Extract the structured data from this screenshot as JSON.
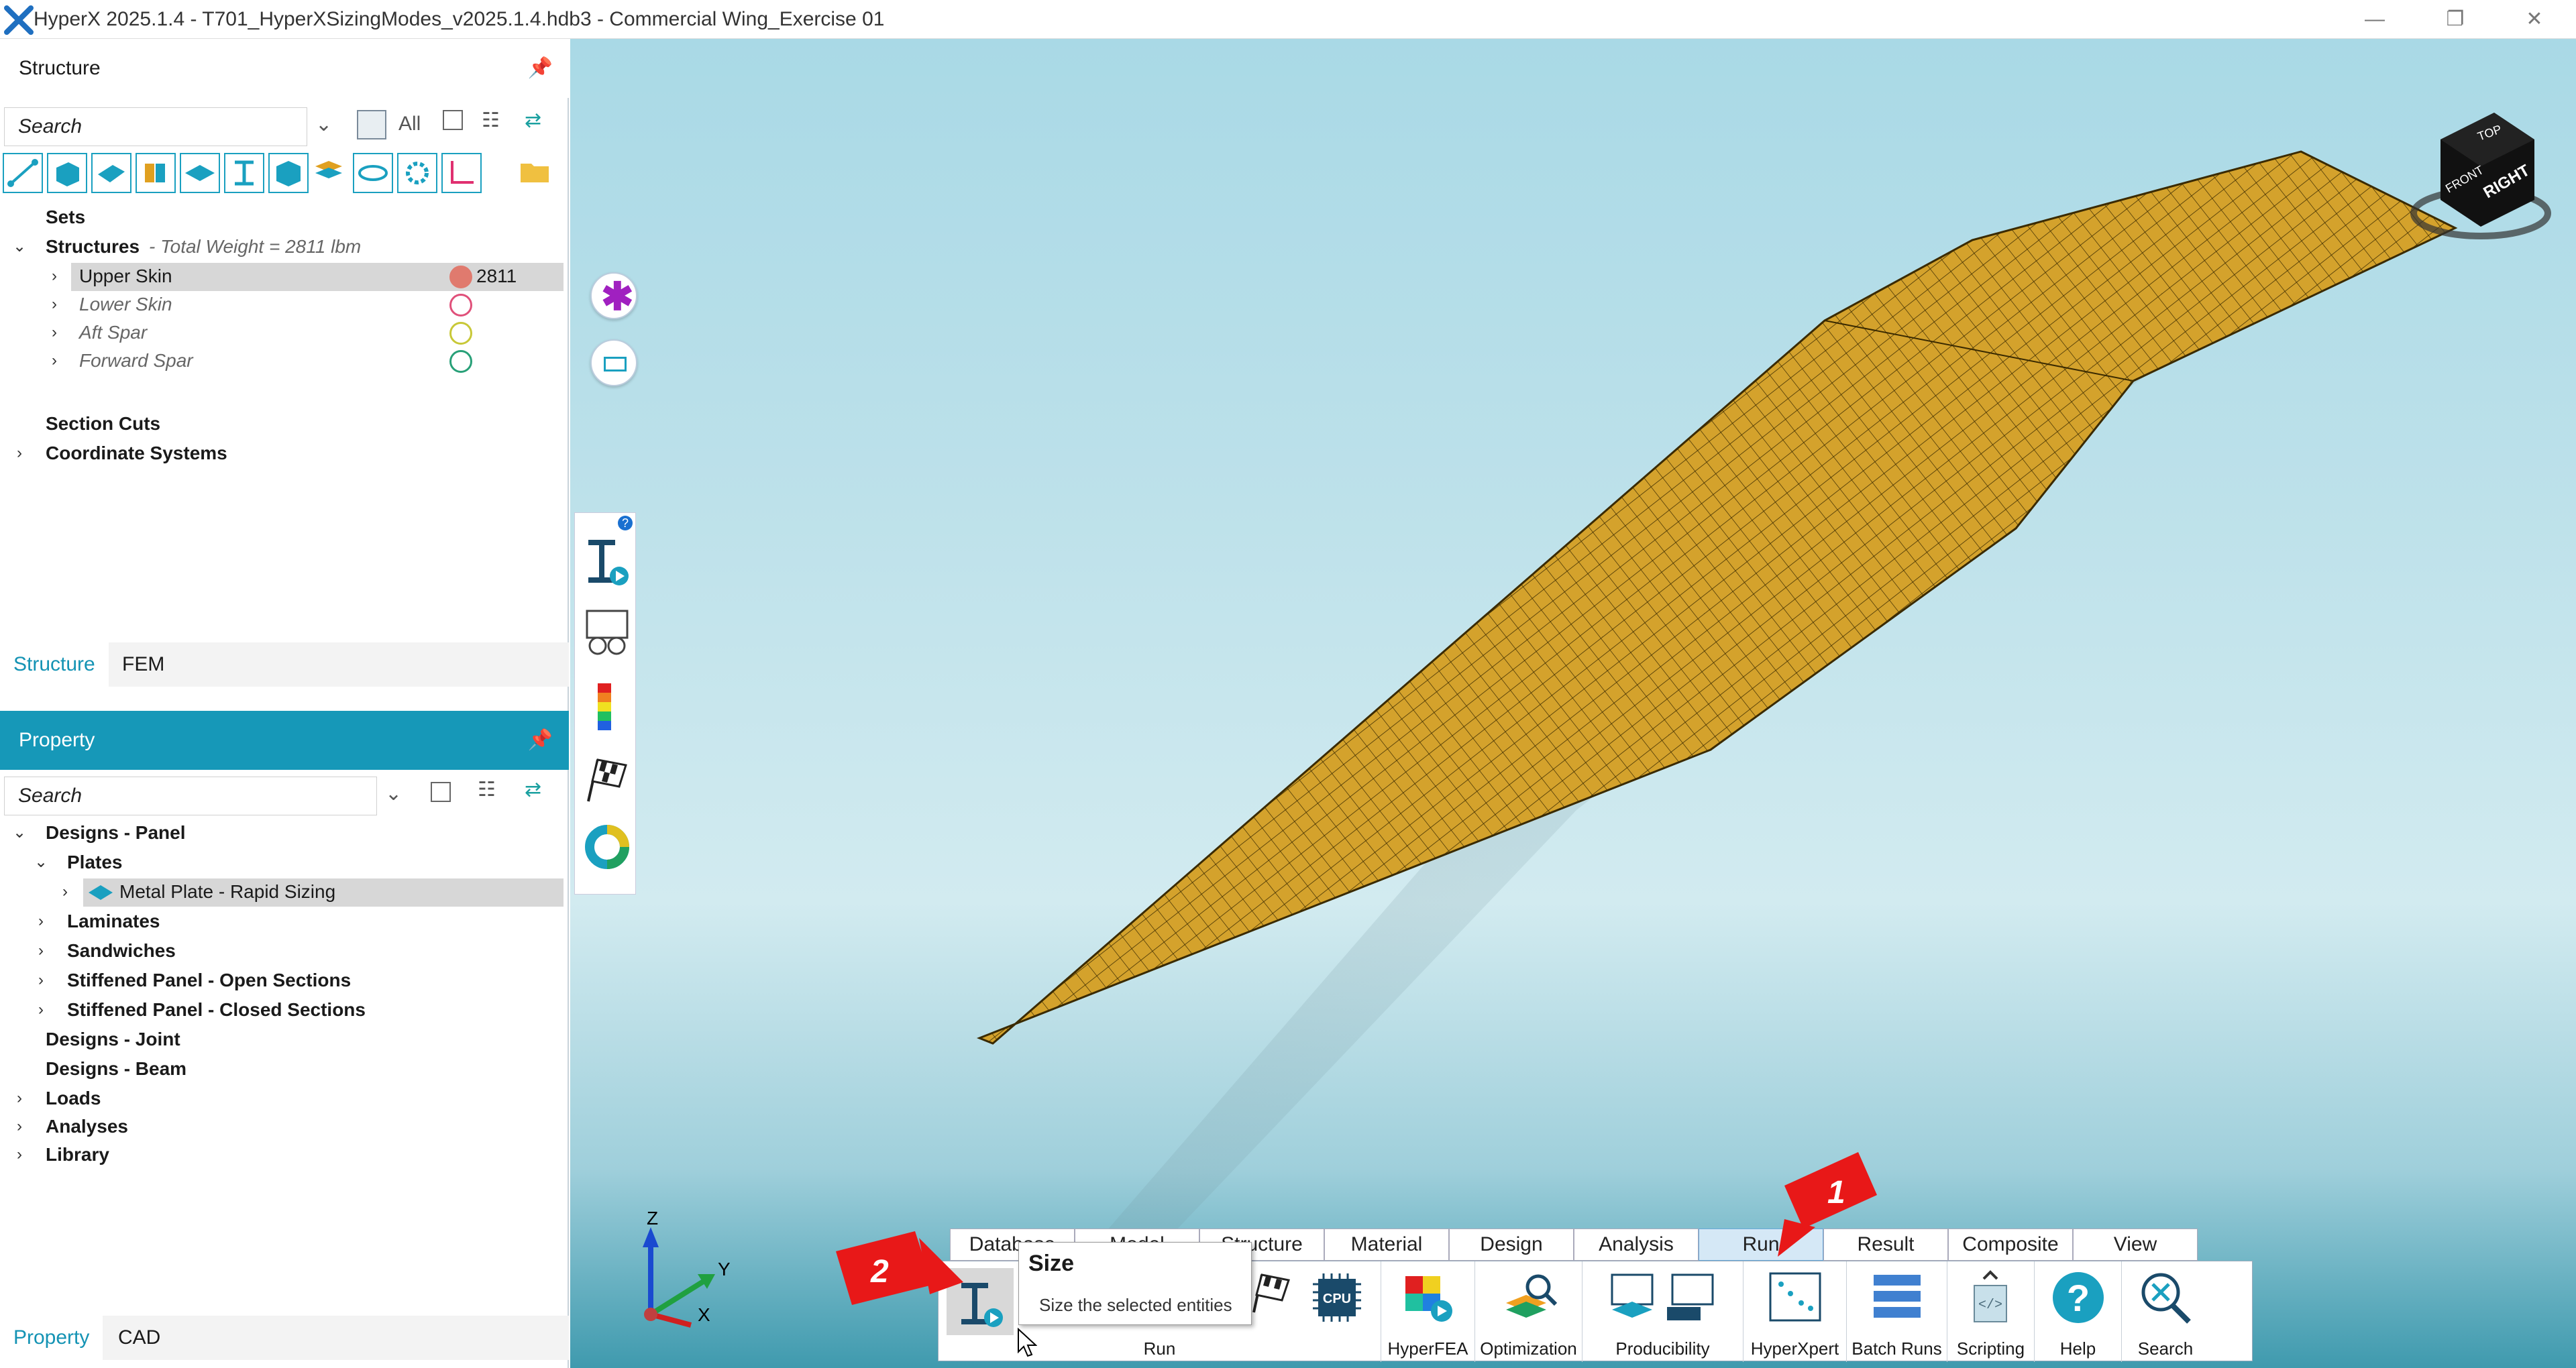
{
  "window": {
    "title": "HyperX 2025.1.4 - T701_HyperXSizingModes_v2025.1.4.hdb3 - Commercial Wing_Exercise 01",
    "min_icon": "minimize-icon",
    "max_icon": "restore-icon",
    "close_icon": "close-icon"
  },
  "structure_panel": {
    "title": "Structure",
    "search_placeholder": "Search",
    "filter_label": "All",
    "tree": {
      "sets": "Sets",
      "structures": "Structures",
      "structures_note": "- Total Weight = 2811 lbm",
      "items": [
        {
          "label": "Upper Skin",
          "value": "2811",
          "color": "#e07a6e",
          "filled": true,
          "selected": true
        },
        {
          "label": "Lower Skin",
          "value": "",
          "color": "#e0507a",
          "filled": false
        },
        {
          "label": "Aft Spar",
          "value": "",
          "color": "#c8c838",
          "filled": false
        },
        {
          "label": "Forward Spar",
          "value": "",
          "color": "#28a078",
          "filled": false
        }
      ],
      "section_cuts": "Section Cuts",
      "coordinate_systems": "Coordinate Systems"
    },
    "tabs": [
      "Structure",
      "FEM"
    ]
  },
  "property_panel": {
    "title": "Property",
    "search_placeholder": "Search",
    "tree": {
      "designs_panel": "Designs - Panel",
      "plates": "Plates",
      "metal_plate": "Metal Plate - Rapid Sizing",
      "laminates": "Laminates",
      "sandwiches": "Sandwiches",
      "open_sections": "Stiffened Panel - Open Sections",
      "closed_sections": "Stiffened Panel - Closed Sections",
      "designs_joint": "Designs - Joint",
      "designs_beam": "Designs - Beam",
      "loads": "Loads",
      "analyses": "Analyses",
      "library": "Library"
    },
    "tabs": [
      "Property",
      "CAD"
    ]
  },
  "viewcube": {
    "label": "RIGHT",
    "top": "TOP",
    "front": "FRONT"
  },
  "axes": {
    "z": "Z",
    "y": "Y",
    "x": "X"
  },
  "ribbon": {
    "tabs": [
      "Database",
      "Model",
      "Structure",
      "Material",
      "Design",
      "Analysis",
      "Run",
      "Result",
      "Composite",
      "View"
    ],
    "active_tab": "Run",
    "groups": {
      "run": "Run",
      "hyperfea": "HyperFEA",
      "optimization": "Optimization",
      "producibility": "Producibility",
      "hyperxpert": "HyperXpert",
      "batch_runs": "Batch Runs",
      "scripting": "Scripting",
      "help": "Help",
      "search": "Search"
    },
    "cpu_label": "CPU"
  },
  "tooltip": {
    "title": "Size",
    "description": "Size the selected entities"
  },
  "callouts": {
    "one": "1",
    "two": "2"
  },
  "help_badge": "?"
}
